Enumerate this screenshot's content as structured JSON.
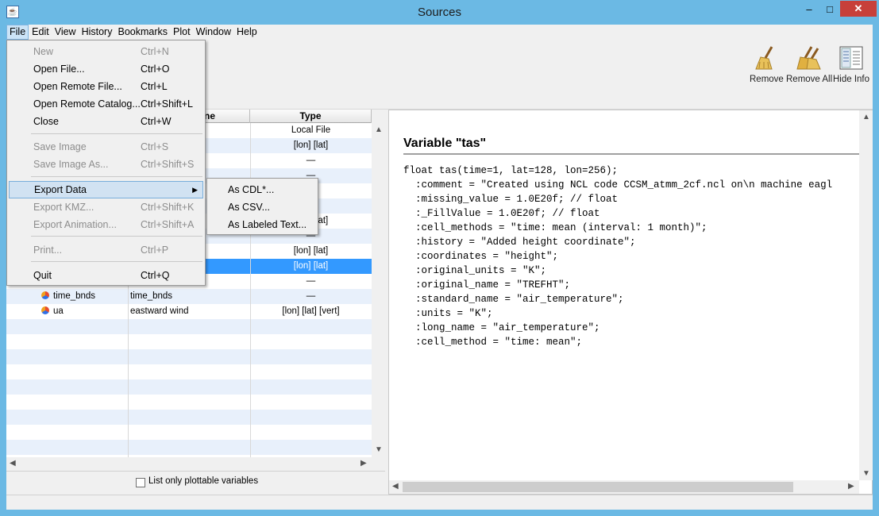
{
  "window": {
    "title": "Sources",
    "minimize": "–",
    "maximize": "□",
    "close": "✕"
  },
  "menubar": [
    "File",
    "Edit",
    "View",
    "History",
    "Bookmarks",
    "Plot",
    "Window",
    "Help"
  ],
  "toolbar": {
    "remove_label": "Remove",
    "remove_all_label": "Remove All",
    "hide_info_label": "Hide Info"
  },
  "table": {
    "col_name_partial": "ne",
    "col_type": "Type",
    "rows": [
      {
        "name": "",
        "long_name": "",
        "type": "Local File",
        "icon": false
      },
      {
        "name": "",
        "long_name": "",
        "type": "[lon] [lat]",
        "icon": false
      },
      {
        "name": "",
        "long_name": "",
        "type": "—",
        "icon": false
      },
      {
        "name": "",
        "long_name": "",
        "type": "—",
        "icon": false
      },
      {
        "name": "",
        "long_name": "",
        "type": "—",
        "icon": false
      },
      {
        "name": "",
        "long_name": "",
        "type": "—",
        "icon": false
      },
      {
        "name": "",
        "long_name": "",
        "type": "[lon] [lat]",
        "icon": false
      },
      {
        "name": "",
        "long_name": "",
        "type": "—",
        "icon": false
      },
      {
        "name": "",
        "long_name": "",
        "type": "[lon] [lat]",
        "icon": false
      },
      {
        "name": "",
        "long_name": "",
        "type": "[lon] [lat]",
        "icon": false
      },
      {
        "name": "",
        "long_name": "",
        "type": "—",
        "icon": false
      },
      {
        "name": "time_bnds",
        "long_name": "time_bnds",
        "type": "—",
        "icon": true
      },
      {
        "name": "ua",
        "long_name": "eastward wind",
        "type": "[lon] [lat] [vert]",
        "icon": true
      }
    ],
    "plottable_label": "List only plottable variables"
  },
  "info": {
    "title": "Variable \"tas\"",
    "text": "float tas(time=1, lat=128, lon=256);\n  :comment = \"Created using NCL code CCSM_atmm_2cf.ncl on\\n machine eagl\n  :missing_value = 1.0E20f; // float\n  :_FillValue = 1.0E20f; // float\n  :cell_methods = \"time: mean (interval: 1 month)\";\n  :history = \"Added height coordinate\";\n  :coordinates = \"height\";\n  :original_units = \"K\";\n  :original_name = \"TREFHT\";\n  :standard_name = \"air_temperature\";\n  :units = \"K\";\n  :long_name = \"air_temperature\";\n  :cell_method = \"time: mean\";"
  },
  "file_menu": {
    "items": [
      {
        "label": "New",
        "accel": "Ctrl+N",
        "disabled": true
      },
      {
        "label": "Open File...",
        "accel": "Ctrl+O",
        "disabled": false
      },
      {
        "label": "Open Remote File...",
        "accel": "Ctrl+L",
        "disabled": false
      },
      {
        "label": "Open Remote Catalog...",
        "accel": "Ctrl+Shift+L",
        "disabled": false
      },
      {
        "label": "Close",
        "accel": "Ctrl+W",
        "disabled": false
      },
      {
        "label": "Save Image",
        "accel": "Ctrl+S",
        "disabled": true
      },
      {
        "label": "Save Image As...",
        "accel": "Ctrl+Shift+S",
        "disabled": true
      },
      {
        "label": "Export Data",
        "accel": "",
        "disabled": false
      },
      {
        "label": "Export KMZ...",
        "accel": "Ctrl+Shift+K",
        "disabled": true
      },
      {
        "label": "Export Animation...",
        "accel": "Ctrl+Shift+A",
        "disabled": true
      },
      {
        "label": "Print...",
        "accel": "Ctrl+P",
        "disabled": true
      },
      {
        "label": "Quit",
        "accel": "Ctrl+Q",
        "disabled": false
      }
    ],
    "export_submenu": [
      "As CDL*...",
      "As CSV...",
      "As Labeled Text..."
    ]
  },
  "colors": {
    "frame": "#6bb9e4",
    "selection": "#3399ff",
    "menu_highlight": "#d1e2f2",
    "close_button": "#c7403a"
  }
}
